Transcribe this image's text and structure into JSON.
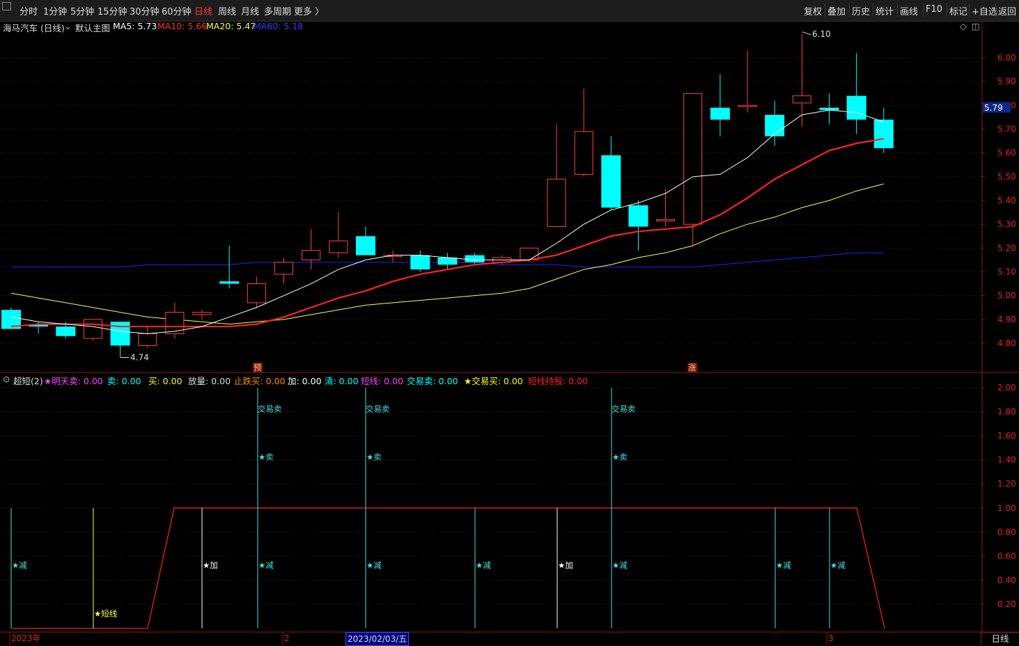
{
  "toolbar": {
    "periods": [
      "分时",
      "1分钟",
      "5分钟",
      "15分钟",
      "30分钟",
      "60分钟",
      "日线",
      "周线",
      "月线",
      "多周期",
      "更多 〉"
    ],
    "active_period": "日线",
    "right": [
      "复权",
      "叠加",
      "历史",
      "统计",
      "画线",
      "F10",
      "标记",
      "+自选",
      "返回"
    ]
  },
  "main": {
    "title": "海马汽车 (日线)",
    "template": "默认主图",
    "ma5": "MA5: 5.73",
    "ma10": "MA10: 5.66",
    "ma20": "MA20: 5.47",
    "ma60": "MA60: 5.18",
    "high_label": "6.10",
    "low_label": "4.74",
    "last_price": "5.79",
    "y_axis": [
      "6.00",
      "5.90",
      "5.80",
      "5.70",
      "5.60",
      "5.50",
      "5.40",
      "5.30",
      "5.20",
      "5.10",
      "5.00",
      "4.90",
      "4.80"
    ],
    "markers": [
      "预",
      "涨"
    ],
    "colors": {
      "up": "#ff4444",
      "down": "#00ffff",
      "ma5": "#ffffff",
      "ma10": "#ff2222",
      "ma20": "#ffff44",
      "ma60": "#2222ff"
    }
  },
  "indicator": {
    "name": "超短(2)",
    "fields": [
      {
        "label": "★明天卖: 0.00",
        "color": "#ff44ff"
      },
      {
        "label": "卖: 0.00",
        "color": "#00ffff"
      },
      {
        "label": "买: 0.00",
        "color": "#ffff00"
      },
      {
        "label": "放量: 0.00",
        "color": "#dddddd"
      },
      {
        "label": "止跌买: 0.00",
        "color": "#ff8800"
      },
      {
        "label": "加: 0.00",
        "color": "#ffffff"
      },
      {
        "label": "清: 0.00",
        "color": "#00ffff"
      },
      {
        "label": "短线: 0.00",
        "color": "#ff44ff"
      },
      {
        "label": "交易卖: 0.00",
        "color": "#00ffff"
      },
      {
        "label": "★交易买: 0.00",
        "color": "#ffff00"
      },
      {
        "label": "短线持股: 0.00",
        "color": "#ff2222"
      }
    ],
    "y_axis": [
      "2.00",
      "1.80",
      "1.60",
      "1.40",
      "1.20",
      "1.00",
      "0.80",
      "0.60",
      "0.40",
      "0.20"
    ],
    "signals": {
      "jian": "★减",
      "jia": "★加",
      "duanxian": "★短线",
      "mai": "★卖",
      "jiaoyimai": "交易卖"
    }
  },
  "x_axis": {
    "labels": [
      "2023年",
      "2",
      "3"
    ],
    "cursor_date": "2023/02/03/五"
  },
  "period_label": "日线",
  "chart_data": {
    "type": "candlestick",
    "y_range": [
      4.74,
      6.1
    ],
    "candles": [
      {
        "o": 4.94,
        "h": 4.95,
        "l": 4.86,
        "c": 4.86
      },
      {
        "o": 4.88,
        "h": 4.89,
        "l": 4.84,
        "c": 4.87
      },
      {
        "o": 4.87,
        "h": 4.89,
        "l": 4.82,
        "c": 4.83
      },
      {
        "o": 4.82,
        "h": 4.9,
        "l": 4.81,
        "c": 4.9
      },
      {
        "o": 4.89,
        "h": 4.89,
        "l": 4.74,
        "c": 4.79
      },
      {
        "o": 4.79,
        "h": 4.87,
        "l": 4.78,
        "c": 4.84
      },
      {
        "o": 4.84,
        "h": 4.97,
        "l": 4.82,
        "c": 4.93
      },
      {
        "o": 4.92,
        "h": 4.94,
        "l": 4.9,
        "c": 4.93
      },
      {
        "o": 5.06,
        "h": 5.21,
        "l": 5.03,
        "c": 5.05
      },
      {
        "o": 4.97,
        "h": 5.08,
        "l": 4.95,
        "c": 5.05
      },
      {
        "o": 5.09,
        "h": 5.16,
        "l": 5.05,
        "c": 5.14
      },
      {
        "o": 5.15,
        "h": 5.28,
        "l": 5.11,
        "c": 5.19
      },
      {
        "o": 5.18,
        "h": 5.35,
        "l": 5.16,
        "c": 5.23
      },
      {
        "o": 5.25,
        "h": 5.29,
        "l": 5.17,
        "c": 5.17
      },
      {
        "o": 5.17,
        "h": 5.19,
        "l": 5.14,
        "c": 5.17
      },
      {
        "o": 5.17,
        "h": 5.19,
        "l": 5.1,
        "c": 5.11
      },
      {
        "o": 5.16,
        "h": 5.18,
        "l": 5.11,
        "c": 5.13
      },
      {
        "o": 5.17,
        "h": 5.18,
        "l": 5.13,
        "c": 5.14
      },
      {
        "o": 5.14,
        "h": 5.17,
        "l": 5.13,
        "c": 5.16
      },
      {
        "o": 5.15,
        "h": 5.2,
        "l": 5.14,
        "c": 5.2
      },
      {
        "o": 5.29,
        "h": 5.72,
        "l": 5.29,
        "c": 5.49
      },
      {
        "o": 5.51,
        "h": 5.87,
        "l": 5.5,
        "c": 5.69
      },
      {
        "o": 5.59,
        "h": 5.67,
        "l": 5.36,
        "c": 5.37
      },
      {
        "o": 5.38,
        "h": 5.4,
        "l": 5.19,
        "c": 5.29
      },
      {
        "o": 5.32,
        "h": 5.45,
        "l": 5.29,
        "c": 5.32
      },
      {
        "o": 5.3,
        "h": 5.85,
        "l": 5.21,
        "c": 5.85
      },
      {
        "o": 5.79,
        "h": 5.93,
        "l": 5.67,
        "c": 5.74
      },
      {
        "o": 5.8,
        "h": 6.03,
        "l": 5.77,
        "c": 5.8
      },
      {
        "o": 5.76,
        "h": 5.82,
        "l": 5.63,
        "c": 5.67
      },
      {
        "o": 5.81,
        "h": 6.1,
        "l": 5.71,
        "c": 5.84
      },
      {
        "o": 5.79,
        "h": 5.85,
        "l": 5.72,
        "c": 5.78
      },
      {
        "o": 5.84,
        "h": 6.02,
        "l": 5.68,
        "c": 5.74
      },
      {
        "o": 5.74,
        "h": 5.79,
        "l": 5.6,
        "c": 5.62
      }
    ],
    "ma5": [
      4.91,
      4.89,
      4.88,
      4.87,
      4.85,
      4.84,
      4.85,
      4.87,
      4.91,
      4.95,
      5.0,
      5.05,
      5.11,
      5.15,
      5.17,
      5.17,
      5.16,
      5.15,
      5.15,
      5.15,
      5.22,
      5.3,
      5.36,
      5.39,
      5.43,
      5.5,
      5.51,
      5.58,
      5.68,
      5.76,
      5.78,
      5.77,
      5.73
    ],
    "ma10": [
      4.87,
      4.88,
      4.88,
      4.88,
      4.87,
      4.87,
      4.87,
      4.87,
      4.87,
      4.88,
      4.91,
      4.95,
      4.99,
      5.02,
      5.06,
      5.09,
      5.11,
      5.13,
      5.14,
      5.15,
      5.17,
      5.21,
      5.25,
      5.27,
      5.28,
      5.29,
      5.34,
      5.41,
      5.49,
      5.55,
      5.61,
      5.64,
      5.66
    ],
    "ma20": [
      5.01,
      4.99,
      4.97,
      4.95,
      4.93,
      4.91,
      4.9,
      4.89,
      4.88,
      4.89,
      4.9,
      4.92,
      4.94,
      4.96,
      4.97,
      4.98,
      4.99,
      5.0,
      5.01,
      5.03,
      5.07,
      5.11,
      5.13,
      5.16,
      5.18,
      5.21,
      5.26,
      5.3,
      5.33,
      5.37,
      5.4,
      5.44,
      5.47
    ],
    "ma60": [
      5.12,
      5.12,
      5.12,
      5.12,
      5.12,
      5.13,
      5.13,
      5.13,
      5.13,
      5.14,
      5.14,
      5.14,
      5.14,
      5.14,
      5.14,
      5.14,
      5.14,
      5.14,
      5.13,
      5.13,
      5.13,
      5.12,
      5.12,
      5.12,
      5.12,
      5.12,
      5.13,
      5.14,
      5.15,
      5.16,
      5.17,
      5.18,
      5.18
    ],
    "indicator_line": [
      0,
      0,
      0,
      0,
      0,
      0,
      1,
      1,
      1,
      1,
      1,
      1,
      1,
      1,
      1,
      1,
      1,
      1,
      1,
      1,
      1,
      1,
      1,
      1,
      1,
      1,
      1,
      1,
      1,
      1,
      1,
      1,
      0
    ],
    "signal_bars": [
      {
        "i": 0,
        "kind": "jian"
      },
      {
        "i": 3,
        "kind": "duanxian"
      },
      {
        "i": 7,
        "kind": "jia"
      },
      {
        "i": 9,
        "kind": "jian",
        "tall": true
      },
      {
        "i": 13,
        "kind": "jian",
        "tall": true
      },
      {
        "i": 17,
        "kind": "jian"
      },
      {
        "i": 20,
        "kind": "jia"
      },
      {
        "i": 22,
        "kind": "jian",
        "tall": true
      },
      {
        "i": 28,
        "kind": "jian"
      },
      {
        "i": 30,
        "kind": "jian"
      }
    ]
  }
}
